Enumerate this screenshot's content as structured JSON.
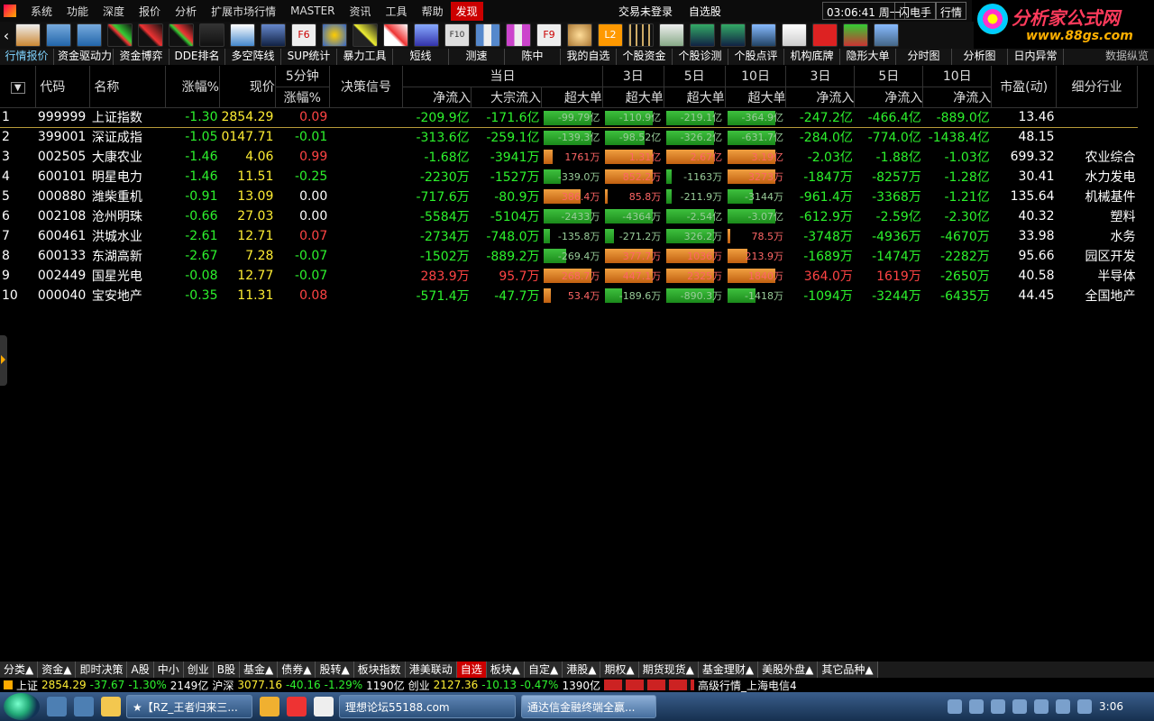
{
  "menu": {
    "items": [
      "系统",
      "功能",
      "深度",
      "报价",
      "分析",
      "扩展市场行情",
      "MASTER",
      "资讯",
      "工具",
      "帮助"
    ],
    "highlight": "发现",
    "center": [
      "交易未登录",
      "自选股"
    ],
    "clock": "03:06:41 周一",
    "btn_flash": "闪电手",
    "btn_market": "行情"
  },
  "logo": {
    "title": "分析家公式网",
    "url": "www.88gs.com"
  },
  "toolbar": {
    "nav_left": "‹",
    "f6": "F6",
    "f9": "F9",
    "l2": "L2",
    "f10": "F10"
  },
  "tabs": [
    "行情报价",
    "资金驱动力",
    "资金博弈",
    "DDE排名",
    "多空阵线",
    "SUP统计",
    "暴力工具",
    "短线",
    "测速",
    "陈中",
    "我的自选",
    "个股资金",
    "个股诊测",
    "个股点评",
    "机构底牌",
    "隐形大单",
    "分时图",
    "分析图",
    "日内异常"
  ],
  "tab_right": "数据纵览",
  "grid": {
    "headers": {
      "sel": "▼",
      "code": "代码",
      "name": "名称",
      "chg": "涨幅%",
      "price": "现价",
      "m5a": "5分钟",
      "m5b": "涨幅%",
      "signal": "决策信号",
      "today": "当日",
      "net": "净流入",
      "block": "大宗流入",
      "super": "超大单",
      "d3": "3日",
      "d5": "5日",
      "d10": "10日",
      "pe": "市盈(动)",
      "industry": "细分行业"
    },
    "rows": [
      {
        "idx": "1",
        "code": "999999",
        "name": "上证指数",
        "chg": "-1.30",
        "price": "2854.29",
        "m5": "0.09",
        "net": "-209.9亿",
        "block": "-171.6亿",
        "s0": "-99.79亿",
        "s3": "-110.9亿",
        "s5": "-219.1亿",
        "s10": "-364.9亿",
        "n3": "-247.2亿",
        "n5": "-466.4亿",
        "n10": "-889.0亿",
        "pe": "13.46",
        "ind": ""
      },
      {
        "idx": "2",
        "code": "399001",
        "name": "深证成指",
        "chg": "-1.05",
        "price": "0147.71",
        "m5": "-0.01",
        "net": "-313.6亿",
        "block": "-259.1亿",
        "s0": "-139.3亿",
        "s3": "-98.52亿",
        "s5": "-326.2亿",
        "s10": "-631.7亿",
        "n3": "-284.0亿",
        "n5": "-774.0亿",
        "n10": "-1438.4亿",
        "pe": "48.15",
        "ind": ""
      },
      {
        "idx": "3",
        "code": "002505",
        "name": "大康农业",
        "chg": "-1.46",
        "price": "4.06",
        "m5": "0.99",
        "net": "-1.68亿",
        "block": "-3941万",
        "s0": "1761万",
        "s3": "1.31亿",
        "s5": "2.67亿",
        "s10": "3.19亿",
        "n3": "-2.03亿",
        "n5": "-1.88亿",
        "n10": "-1.03亿",
        "pe": "699.32",
        "ind": "农业综合"
      },
      {
        "idx": "4",
        "code": "600101",
        "name": "明星电力",
        "chg": "-1.46",
        "price": "11.51",
        "m5": "-0.25",
        "net": "-2230万",
        "block": "-1527万",
        "s0": "-339.0万",
        "s3": "852.2万",
        "s5": "-1163万",
        "s10": "3273万",
        "n3": "-1847万",
        "n5": "-8257万",
        "n10": "-1.28亿",
        "pe": "30.41",
        "ind": "水力发电"
      },
      {
        "idx": "5",
        "code": "000880",
        "name": "潍柴重机",
        "chg": "-0.91",
        "price": "13.09",
        "m5": "0.00",
        "net": "-717.6万",
        "block": "-80.9万",
        "s0": "386.4万",
        "s3": "85.8万",
        "s5": "-211.9万",
        "s10": "-3144万",
        "n3": "-961.4万",
        "n5": "-3368万",
        "n10": "-1.21亿",
        "pe": "135.64",
        "ind": "机械基件"
      },
      {
        "idx": "6",
        "code": "002108",
        "name": "沧州明珠",
        "chg": "-0.66",
        "price": "27.03",
        "m5": "0.00",
        "net": "-5584万",
        "block": "-5104万",
        "s0": "-2433万",
        "s3": "-4364万",
        "s5": "-2.54亿",
        "s10": "-3.07亿",
        "n3": "-612.9万",
        "n5": "-2.59亿",
        "n10": "-2.30亿",
        "pe": "40.32",
        "ind": "塑料"
      },
      {
        "idx": "7",
        "code": "600461",
        "name": "洪城水业",
        "chg": "-2.61",
        "price": "12.71",
        "m5": "0.07",
        "net": "-2734万",
        "block": "-748.0万",
        "s0": "-135.8万",
        "s3": "-271.2万",
        "s5": "326.2万",
        "s10": "78.5万",
        "n3": "-3748万",
        "n5": "-4936万",
        "n10": "-4670万",
        "pe": "33.98",
        "ind": "水务"
      },
      {
        "idx": "8",
        "code": "600133",
        "name": "东湖高新",
        "chg": "-2.67",
        "price": "7.28",
        "m5": "-0.07",
        "net": "-1502万",
        "block": "-889.2万",
        "s0": "-269.4万",
        "s3": "377.7万",
        "s5": "1036万",
        "s10": "213.9万",
        "n3": "-1689万",
        "n5": "-1474万",
        "n10": "-2282万",
        "pe": "95.66",
        "ind": "园区开发"
      },
      {
        "idx": "9",
        "code": "002449",
        "name": "国星光电",
        "chg": "-0.08",
        "price": "12.77",
        "m5": "-0.07",
        "net": "283.9万",
        "block": "95.7万",
        "s0": "268.7万",
        "s3": "447.1万",
        "s5": "2325万",
        "s10": "1840万",
        "n3": "364.0万",
        "n5": "1619万",
        "n10": "-2650万",
        "pe": "40.58",
        "ind": "半导体"
      },
      {
        "idx": "10",
        "code": "000040",
        "name": "宝安地产",
        "chg": "-0.35",
        "price": "11.31",
        "m5": "0.08",
        "net": "-571.4万",
        "block": "-47.7万",
        "s0": "53.4万",
        "s3": "-189.6万",
        "s5": "-890.3万",
        "s10": "-1418万",
        "n3": "-1094万",
        "n5": "-3244万",
        "n10": "-6435万",
        "pe": "44.45",
        "ind": "全国地产"
      }
    ],
    "bars": [
      {
        "s0": [
          0.85,
          "g"
        ],
        "s3": [
          0.85,
          "g"
        ],
        "s5": [
          0.85,
          "g"
        ],
        "s10": [
          0.85,
          "g"
        ]
      },
      {
        "s0": [
          0.85,
          "g"
        ],
        "s3": [
          0.7,
          "g"
        ],
        "s5": [
          0.85,
          "g"
        ],
        "s10": [
          0.85,
          "g"
        ]
      },
      {
        "s0": [
          0.15,
          "r"
        ],
        "s3": [
          0.85,
          "r"
        ],
        "s5": [
          0.85,
          "r"
        ],
        "s10": [
          0.85,
          "r"
        ]
      },
      {
        "s0": [
          0.3,
          "g"
        ],
        "s3": [
          0.85,
          "r"
        ],
        "s5": [
          0.1,
          "g"
        ],
        "s10": [
          0.85,
          "r"
        ]
      },
      {
        "s0": [
          0.65,
          "r"
        ],
        "s3": [
          0.05,
          "r"
        ],
        "s5": [
          0.1,
          "g"
        ],
        "s10": [
          0.45,
          "g"
        ]
      },
      {
        "s0": [
          0.85,
          "g"
        ],
        "s3": [
          0.85,
          "g"
        ],
        "s5": [
          0.85,
          "g"
        ],
        "s10": [
          0.85,
          "g"
        ]
      },
      {
        "s0": [
          0.1,
          "g"
        ],
        "s3": [
          0.15,
          "g"
        ],
        "s5": [
          0.85,
          "g"
        ],
        "s10": [
          0.05,
          "r"
        ]
      },
      {
        "s0": [
          0.4,
          "g"
        ],
        "s3": [
          0.85,
          "r"
        ],
        "s5": [
          0.85,
          "r"
        ],
        "s10": [
          0.35,
          "r"
        ]
      },
      {
        "s0": [
          0.85,
          "r"
        ],
        "s3": [
          0.85,
          "r"
        ],
        "s5": [
          0.85,
          "r"
        ],
        "s10": [
          0.85,
          "r"
        ]
      },
      {
        "s0": [
          0.12,
          "r"
        ],
        "s3": [
          0.3,
          "g"
        ],
        "s5": [
          0.85,
          "g"
        ],
        "s10": [
          0.5,
          "g"
        ]
      }
    ]
  },
  "bottom_tabs": [
    "分类▲",
    "资金▲",
    "即时决策",
    "A股",
    "中小",
    "创业",
    "B股",
    "基金▲",
    "债券▲",
    "股转▲",
    "板块指数",
    "港美联动",
    "自选",
    "板块▲",
    "自定▲",
    "港股▲",
    "期权▲",
    "期货现货▲",
    "基金理财▲",
    "美股外盘▲",
    "其它品种▲"
  ],
  "bottom_active": "自选",
  "status": {
    "sh_label": "上证",
    "sh_val": "2854.29",
    "sh_chg": "-37.67",
    "sh_pct": "-1.30%",
    "sh_amt": "2149亿",
    "hs_label": "沪深",
    "hs_val": "3077.16",
    "hs_chg": "-40.16",
    "hs_pct": "-1.29%",
    "hs_amt": "1190亿",
    "cy_label": "创业",
    "cy_val": "2127.36",
    "cy_chg": "-10.13",
    "cy_pct": "-0.47%",
    "cy_amt": "1390亿",
    "feed": "高级行情_上海电信4"
  },
  "taskbar": {
    "tasks": [
      "★【RZ_王者归来三...",
      "理想论坛55188.com",
      "通达信金融终端全赢..."
    ],
    "time": "3:06"
  }
}
